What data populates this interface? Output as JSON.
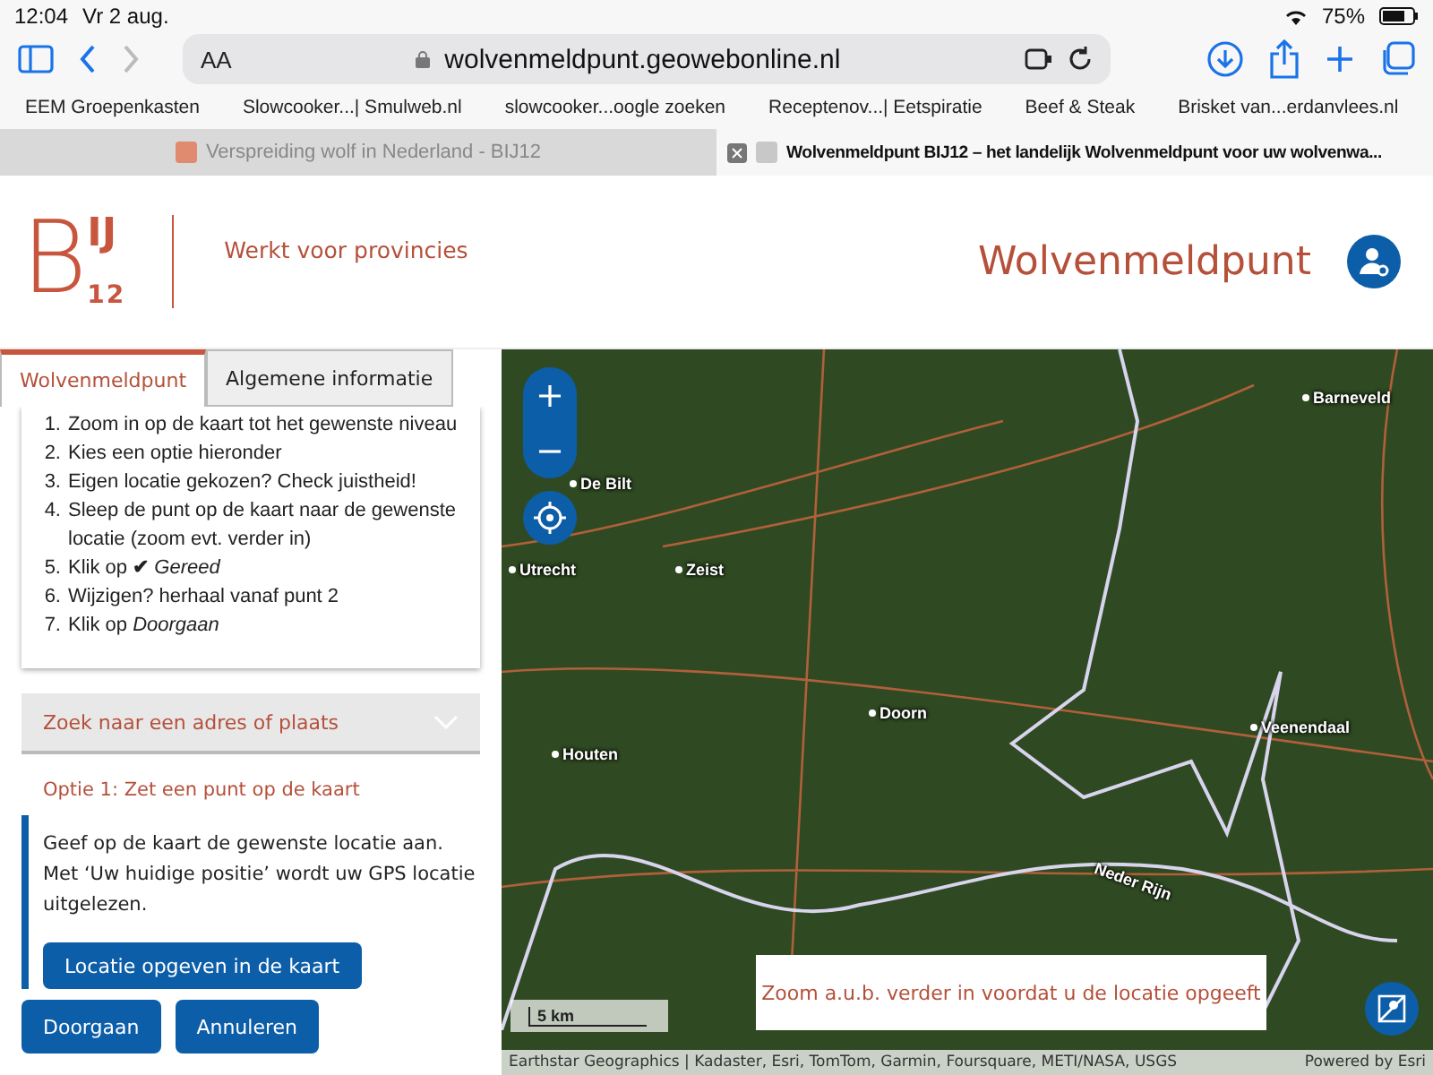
{
  "status_bar": {
    "time": "12:04",
    "date": "Vr 2 aug.",
    "battery": "75%"
  },
  "browser": {
    "text_size_button": "AA",
    "url": "wolvenmeldpunt.geowebonline.nl"
  },
  "bookmarks": [
    "EEM Groepenkasten",
    "Slowcooker...| Smulweb.nl",
    "slowcooker...oogle zoeken",
    "Receptenov...| Eetspiratie",
    "Beef & Steak",
    "Brisket van...erdanvlees.nl"
  ],
  "tabs": [
    {
      "title": "Verspreiding wolf in Nederland - BIJ12",
      "selected": false
    },
    {
      "title": "Wolvenmeldpunt BIJ12 – het landelijk Wolvenmeldpunt voor uw wolvenwa...",
      "selected": true
    }
  ],
  "header": {
    "logo": {
      "letter": "B",
      "ij": "IJ",
      "number": "12"
    },
    "tagline": "Werkt voor provincies",
    "site_title": "Wolvenmeldpunt"
  },
  "panel_tabs": [
    {
      "label": "Wolvenmeldpunt",
      "selected": true
    },
    {
      "label": "Algemene informatie",
      "selected": false
    }
  ],
  "steps": [
    {
      "number": "1.",
      "text": "Zoom in op de kaart tot het gewenste niveau"
    },
    {
      "number": "2.",
      "text": "Kies een optie hieronder"
    },
    {
      "number": "3.",
      "text": "Eigen locatie gekozen? Check juistheid!"
    },
    {
      "number": "4.",
      "text": "Sleep de punt op de kaart naar de gewenste locatie (zoom evt. verder in)"
    },
    {
      "number": "5.",
      "text": "Klik op **✔** *Gereed*"
    },
    {
      "number": "6.",
      "text": "Wijzigen? herhaal vanaf punt 2"
    },
    {
      "number": "7.",
      "text": "Klik op *Doorgaan*"
    }
  ],
  "search_accordion": {
    "label": "Zoek naar een adres of plaats",
    "expanded": false
  },
  "option": {
    "title": "Optie 1: Zet een punt op de kaart",
    "text": "Geef op de kaart de gewenste locatie aan. Met ‘Uw huidige positie’ wordt uw GPS locatie uitgelezen.",
    "button": "Locatie opgeven in de kaart"
  },
  "actions": [
    "Doorgaan",
    "Annuleren"
  ],
  "map": {
    "places": [
      "Barneveld",
      "De Bilt",
      "Utrecht",
      "Zeist",
      "Doorn",
      "Houten",
      "Veenendaal"
    ],
    "river": "Neder Rijn",
    "scale": "5 km",
    "message": "Zoom a.u.b. verder in voordat u de locatie opgeeft",
    "attribution": "Earthstar Geographics | Kadaster, Esri, TomTom, Garmin, Foursquare, METI/NASA, USGS",
    "powered_label": "Powered by",
    "powered_link": "Esri"
  }
}
